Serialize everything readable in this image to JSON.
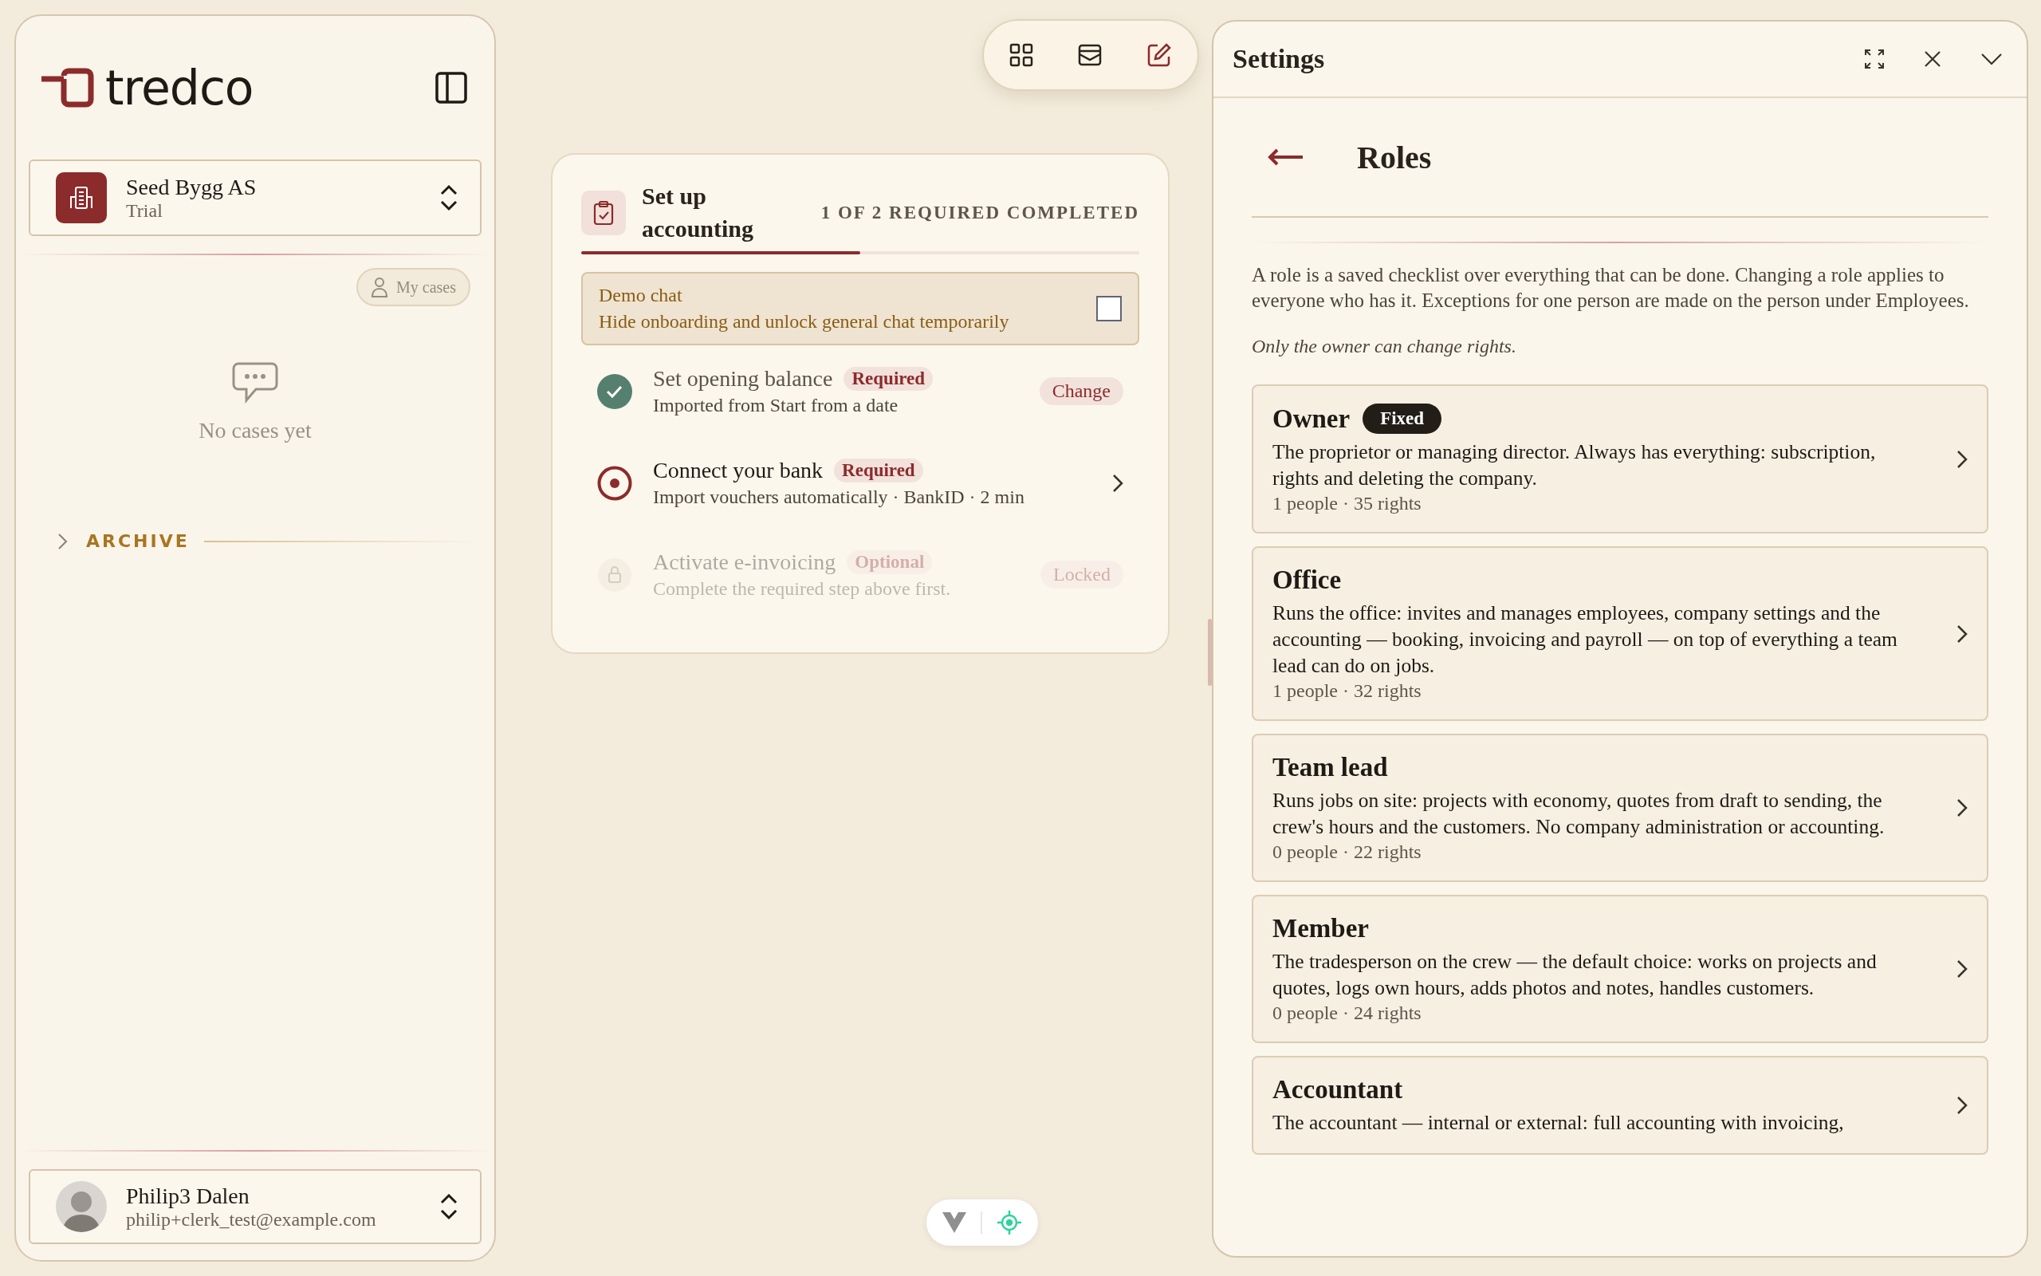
{
  "sidebar": {
    "logo": "tredco",
    "company": {
      "name": "Seed Bygg AS",
      "plan": "Trial"
    },
    "my_cases_button": "My cases",
    "empty_state": "No cases yet",
    "archive": {
      "label": "ARCHIVE",
      "expanded": false
    },
    "user": {
      "name": "Philip3 Dalen",
      "email": "philip+clerk_test@example.com"
    }
  },
  "setup": {
    "title": "Set up accounting",
    "progress_text": "1 OF 2 REQUIRED COMPLETED",
    "level": 0.5,
    "demo": {
      "title": "Demo chat",
      "description": "Hide onboarding and unlock general chat temporarily",
      "checked": false
    },
    "steps": [
      {
        "kind": "done",
        "title": "Set opening balance",
        "tag": "Required",
        "subtitle": "Imported from Start from a date",
        "action": "Change"
      },
      {
        "kind": "current",
        "title": "Connect your bank",
        "tag": "Required",
        "subtitle": "Import vouchers automatically · BankID · 2 min"
      },
      {
        "kind": "locked",
        "title": "Activate e-invoicing",
        "tag": "Optional",
        "subtitle": "Complete the required step above first.",
        "action": "Locked"
      }
    ]
  },
  "settings": {
    "title": "Settings",
    "page_title": "Roles",
    "intro": "A role is a saved checklist over everything that can be done. Changing a role applies to everyone who has it. Exceptions for one person are made on the person under Employees.",
    "note": "Only the owner can change rights.",
    "roles": [
      {
        "name": "Owner",
        "badge": "Fixed",
        "description": "The proprietor or managing director. Always has everything: subscription, rights and deleting the company.",
        "meta": "1 people · 35 rights"
      },
      {
        "name": "Office",
        "description": "Runs the office: invites and manages employees, company settings and the accounting — booking, invoicing and payroll — on top of everything a team lead can do on jobs.",
        "meta": "1 people · 32 rights"
      },
      {
        "name": "Team lead",
        "description": "Runs jobs on site: projects with economy, quotes from draft to sending, the crew's hours and the customers. No company administration or accounting.",
        "meta": "0 people · 22 rights"
      },
      {
        "name": "Member",
        "description": "The tradesperson on the crew — the default choice: works on projects and quotes, logs own hours, adds photos and notes, handles customers.",
        "meta": "0 people · 24 rights"
      },
      {
        "name": "Accountant",
        "description": "The accountant — internal or external: full accounting with invoicing,"
      }
    ]
  }
}
